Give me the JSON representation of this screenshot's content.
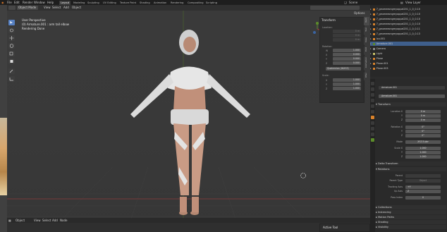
{
  "menu": {
    "items": [
      "File",
      "Edit",
      "Render",
      "Window",
      "Help"
    ]
  },
  "workspaces": {
    "tabs": [
      "Layout",
      "Modeling",
      "Sculpting",
      "UV Editing",
      "Texture Paint",
      "Shading",
      "Animation",
      "Rendering",
      "Compositing",
      "Scripting"
    ],
    "active": "Layout"
  },
  "topright": {
    "scene": "Scene",
    "view_layer": "View Layer"
  },
  "viewport_header": {
    "mode": "Object Mode",
    "menus": [
      "View",
      "Select",
      "Add",
      "Object"
    ],
    "options": "Options"
  },
  "overlay_text": {
    "line1": "User Perspective",
    "line2": "(0) Armature.001 : arm tall elbow",
    "line3": "Rendering Done"
  },
  "npanel": {
    "title": "Transform",
    "location_label": "Location:",
    "loc": [
      "0 m",
      "0 m",
      "0 m"
    ],
    "rotation_label": "Rotation:",
    "rot": [
      {
        "axis": "W",
        "value": "1.000"
      },
      {
        "axis": "X",
        "value": "0.000"
      },
      {
        "axis": "Y",
        "value": "0.000"
      },
      {
        "axis": "Z",
        "value": "0.000"
      }
    ],
    "rot_mode": "Quaternion (WXYZ)",
    "scale_label": "Scale:",
    "scale": [
      {
        "axis": "X",
        "value": "1.000"
      },
      {
        "axis": "Y",
        "value": "1.000"
      },
      {
        "axis": "Z",
        "value": "1.000"
      }
    ],
    "tabs": [
      "Item",
      "Tool",
      "View",
      "Edit",
      "Animation",
      "Misc"
    ]
  },
  "footer": {
    "mode": "Object",
    "menus": [
      "View",
      "Select",
      "Add",
      "Node"
    ]
  },
  "active_tool": {
    "label": "Active Tool"
  },
  "outliner": {
    "rows": [
      {
        "label": "7_geumeeongmyoppal201_1_0_0.10",
        "sel": false
      },
      {
        "label": "7_geumeeongmyoppal201_1_0_0.10",
        "sel": false
      },
      {
        "label": "7_geumeeongmyoppal201_1_0_0.10",
        "sel": false
      },
      {
        "label": "7_geumeeongmyoppal201_1_0_0.10",
        "sel": false
      },
      {
        "label": "7_geumeeongmyoppal201_1_0_0.11",
        "sel": false
      },
      {
        "label": "7_geumeeongmyoppal201_1_0_0.13",
        "sel": false
      },
      {
        "label": "Ico.001",
        "sel": false
      },
      {
        "label": "Armature.001",
        "sel": true
      },
      {
        "label": "Camera",
        "sel": false
      },
      {
        "label": "Light",
        "sel": false
      },
      {
        "label": "Plane",
        "sel": false
      },
      {
        "label": "Plane.001",
        "sel": false
      },
      {
        "label": "Plane.003",
        "sel": false
      }
    ]
  },
  "properties": {
    "object_name": "Armature.001",
    "object_name2": "Armature.001",
    "sections": {
      "transform": "Transform",
      "delta": "Delta Transform",
      "relations": "Relations",
      "collections": "Collections",
      "instancing": "Instancing",
      "motion_paths": "Motion Paths",
      "shading": "Shading",
      "visibility": "Visibility"
    },
    "location": {
      "label": "Location X",
      "y": "Y",
      "z": "Z",
      "values": [
        "0 m",
        "0 m",
        "0 m"
      ]
    },
    "rotation": {
      "label": "Rotation X",
      "y": "Y",
      "z": "Z",
      "values": [
        "0°",
        "0°",
        "0°"
      ]
    },
    "mode": {
      "label": "Mode",
      "value": "XYZ Euler"
    },
    "scale": {
      "label": "Scale X",
      "y": "Y",
      "z": "Z",
      "values": [
        "1.000",
        "1.000",
        "1.000"
      ]
    },
    "parent": {
      "label": "Parent",
      "value": ""
    },
    "parent_type": {
      "label": "Parent Type",
      "value": "Object"
    },
    "tracking": {
      "label": "Tracking Axis",
      "value": "+Y"
    },
    "up_axis": {
      "label": "Up Axis",
      "value": "Z"
    },
    "pass_index": {
      "label": "Pass Index",
      "value": "0"
    }
  },
  "colors": {
    "accent": "#5680c2",
    "selection": "#3f5f8c",
    "axis_red": "#a23a3a",
    "axis_green": "#5c8c2a",
    "orange": "#d9822b"
  }
}
